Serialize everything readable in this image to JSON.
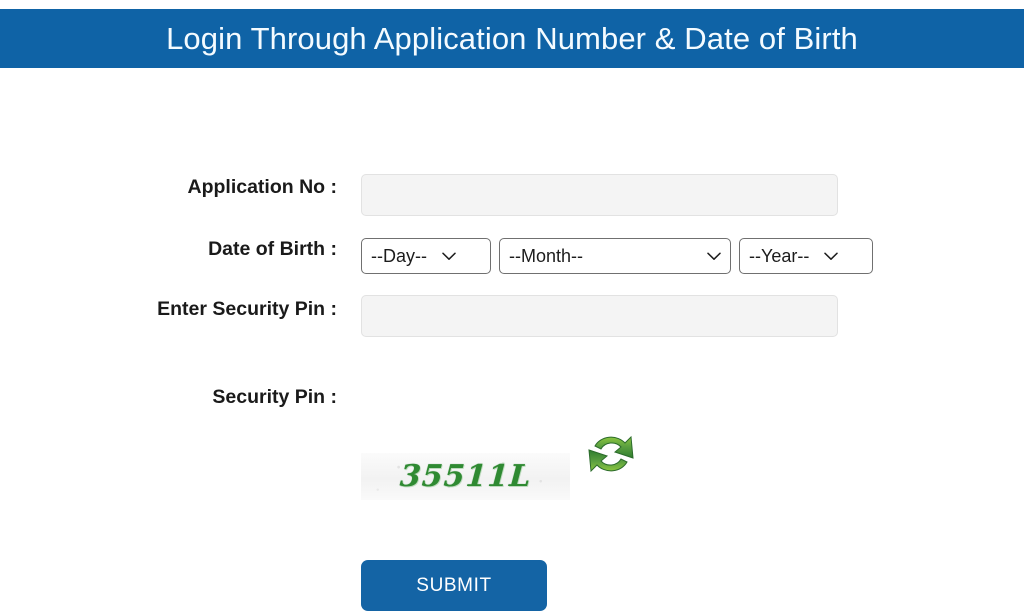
{
  "header": {
    "title": "Login Through Application Number & Date of Birth",
    "background_color": "#0f63a6",
    "text_color": "#f4fbff"
  },
  "form": {
    "fields": [
      {
        "label": "Application No :",
        "type": "text",
        "value": "",
        "placeholder": ""
      },
      {
        "label": "Date of Birth :",
        "type": "date-group"
      },
      {
        "label": "Enter Security Pin :",
        "type": "text",
        "value": "",
        "placeholder": ""
      },
      {
        "label": "Security Pin :",
        "type": "captcha"
      }
    ],
    "application_no": {
      "label": "Application No :",
      "value": "",
      "placeholder": ""
    },
    "date_of_birth": {
      "label": "Date of Birth :",
      "day": {
        "selected": "--Day--"
      },
      "month": {
        "selected": "--Month--"
      },
      "year": {
        "selected": "--Year--"
      }
    },
    "enter_security_pin": {
      "label": "Enter Security Pin :",
      "value": "",
      "placeholder": ""
    },
    "security_pin": {
      "label": "Security Pin :",
      "captcha_text": "35511L",
      "captcha_color": "#2f8a32",
      "refresh_icon": "refresh-icon"
    }
  },
  "actions": {
    "submit_label": "SUBMIT",
    "submit_color": "#1464a5"
  },
  "icons": {
    "chevron_down": "chevron-down-icon",
    "refresh": "refresh-icon"
  }
}
